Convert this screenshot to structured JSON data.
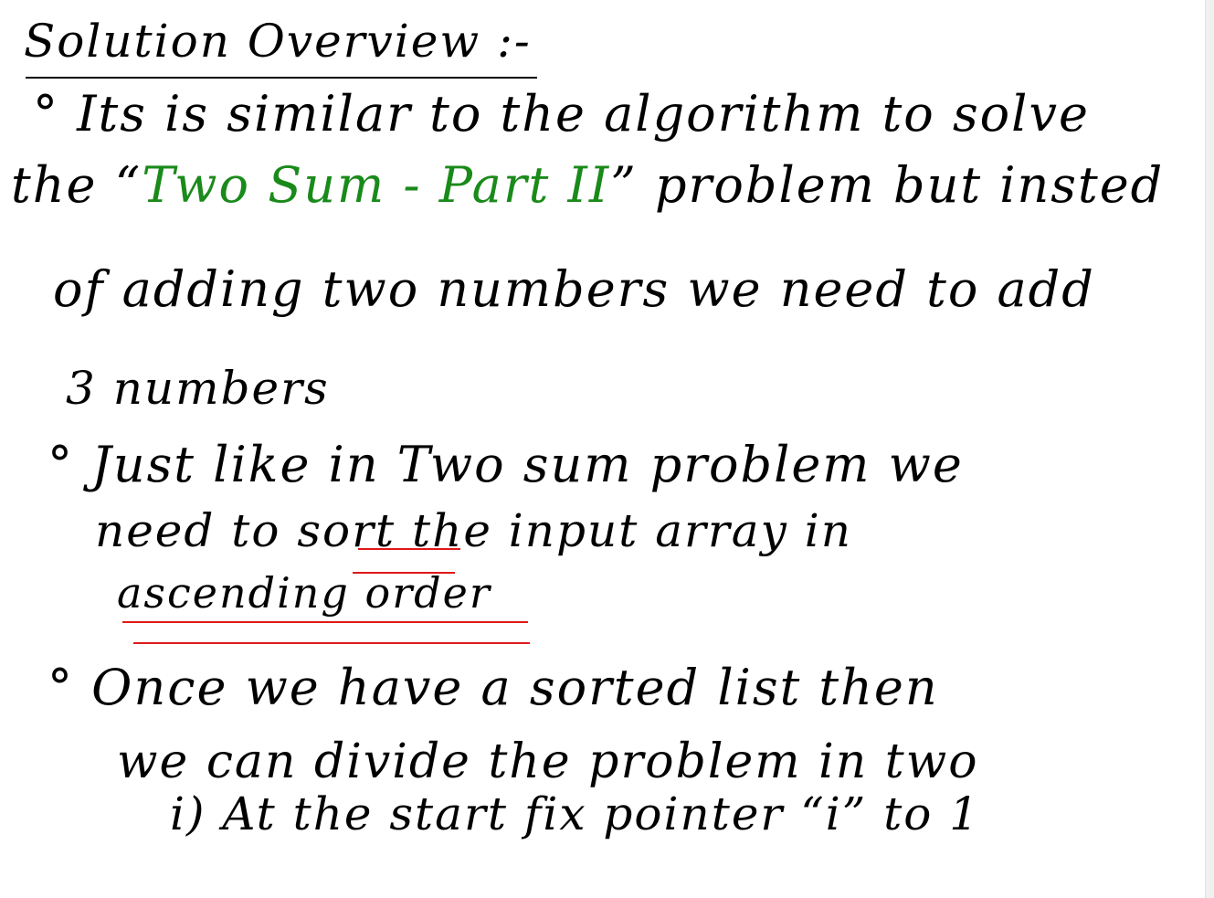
{
  "notes": {
    "title": "Solution Overview :-",
    "lines": [
      {
        "bullet": "°",
        "text": "Its is similar to the algorithm to solve"
      },
      {
        "pre": "the “",
        "highlight": "Two Sum - Part II",
        "post": "” problem but insted"
      },
      {
        "text": "of adding two numbers we need to add"
      },
      {
        "text": "3 numbers"
      },
      {
        "bullet": "°",
        "text": "Just like in Two sum problem we"
      },
      {
        "text": "need to sort the input array in"
      },
      {
        "text": "ascending order"
      },
      {
        "bullet": "°",
        "text": "Once we have a sorted list then"
      },
      {
        "text": "we can divide the problem in two"
      },
      {
        "text": "i) At the start fix pointer “i” to 1"
      }
    ]
  },
  "colors": {
    "ink": "#000000",
    "highlight": "#1a8a1a",
    "underline": "#e01818"
  }
}
